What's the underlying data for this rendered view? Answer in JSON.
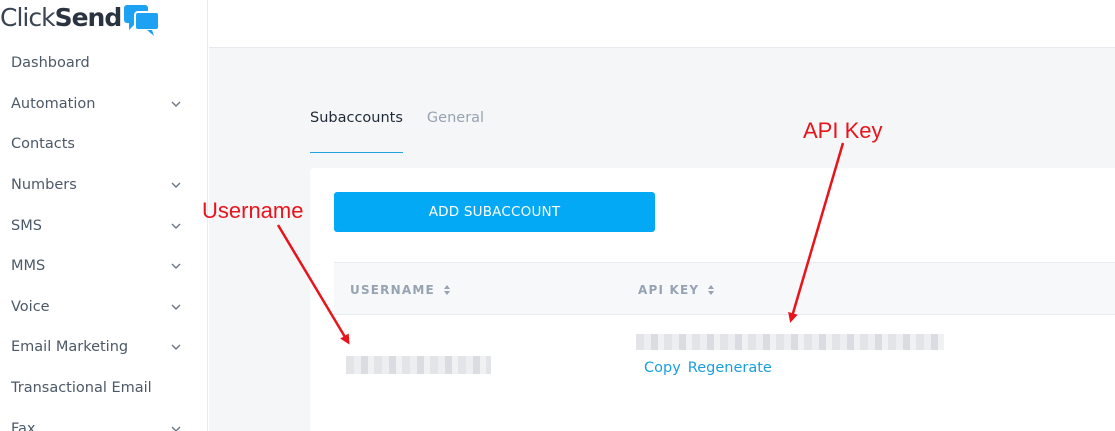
{
  "logo": {
    "text_light": "Click",
    "text_bold": "Send",
    "icon": "chat-bubbles-icon",
    "icon_color": "#1da1f2"
  },
  "sidebar": {
    "items": [
      {
        "label": "Dashboard",
        "has_chevron": false
      },
      {
        "label": "Automation",
        "has_chevron": true
      },
      {
        "label": "Contacts",
        "has_chevron": false
      },
      {
        "label": "Numbers",
        "has_chevron": true
      },
      {
        "label": "SMS",
        "has_chevron": true
      },
      {
        "label": "MMS",
        "has_chevron": true
      },
      {
        "label": "Voice",
        "has_chevron": true
      },
      {
        "label": "Email Marketing",
        "has_chevron": true
      },
      {
        "label": "Transactional Email",
        "has_chevron": false
      },
      {
        "label": "Fax",
        "has_chevron": true
      }
    ]
  },
  "tabs": [
    {
      "label": "Subaccounts",
      "active": true
    },
    {
      "label": "General",
      "active": false
    }
  ],
  "card": {
    "add_button_label": "ADD SUBACCOUNT",
    "columns": [
      {
        "label": "USERNAME",
        "sortable": true
      },
      {
        "label": "API KEY",
        "sortable": true
      }
    ],
    "row": {
      "username": "",
      "api_key": "",
      "actions": [
        "Copy",
        "Regenerate"
      ]
    }
  },
  "annotations": {
    "username_label": "Username",
    "api_key_label": "API Key",
    "color": "#e8141c"
  },
  "colors": {
    "accent": "#03a9f4",
    "link": "#1a9fdc",
    "page_bg": "#f4f6f8"
  }
}
